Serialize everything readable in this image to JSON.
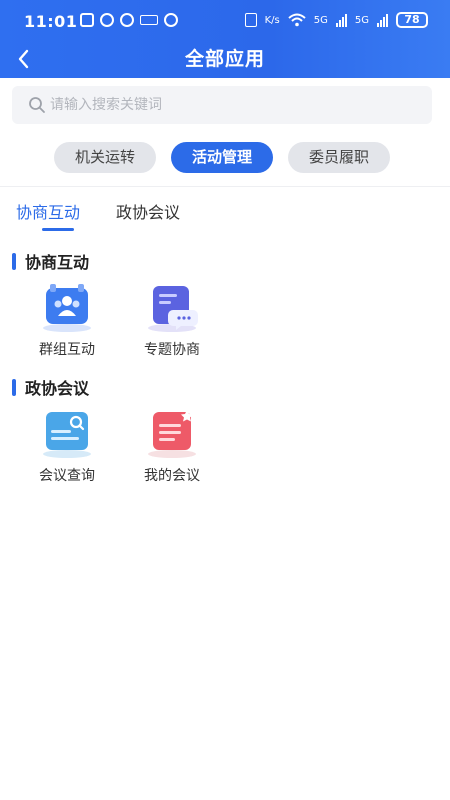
{
  "status_bar": {
    "time": "11:01",
    "network_1": "5G",
    "network_2": "5G",
    "speed": "K/s",
    "battery": "78"
  },
  "header": {
    "title": "全部应用"
  },
  "search": {
    "placeholder": "请输入搜索关键词",
    "value": ""
  },
  "categories": [
    {
      "label": "机关运转",
      "active": false
    },
    {
      "label": "活动管理",
      "active": true
    },
    {
      "label": "委员履职",
      "active": false
    }
  ],
  "tabs": [
    {
      "label": "协商互动",
      "active": true
    },
    {
      "label": "政协会议",
      "active": false
    }
  ],
  "sections": [
    {
      "title": "协商互动",
      "apps": [
        {
          "label": "群组互动",
          "icon": "group-icon"
        },
        {
          "label": "专题协商",
          "icon": "topic-chat-icon"
        }
      ]
    },
    {
      "title": "政协会议",
      "apps": [
        {
          "label": "会议查询",
          "icon": "meeting-search-icon"
        },
        {
          "label": "我的会议",
          "icon": "my-meeting-icon"
        }
      ]
    }
  ],
  "colors": {
    "primary": "#2c6be8",
    "chip_inactive": "#e3e5ea",
    "search_bg": "#f3f4f7"
  }
}
